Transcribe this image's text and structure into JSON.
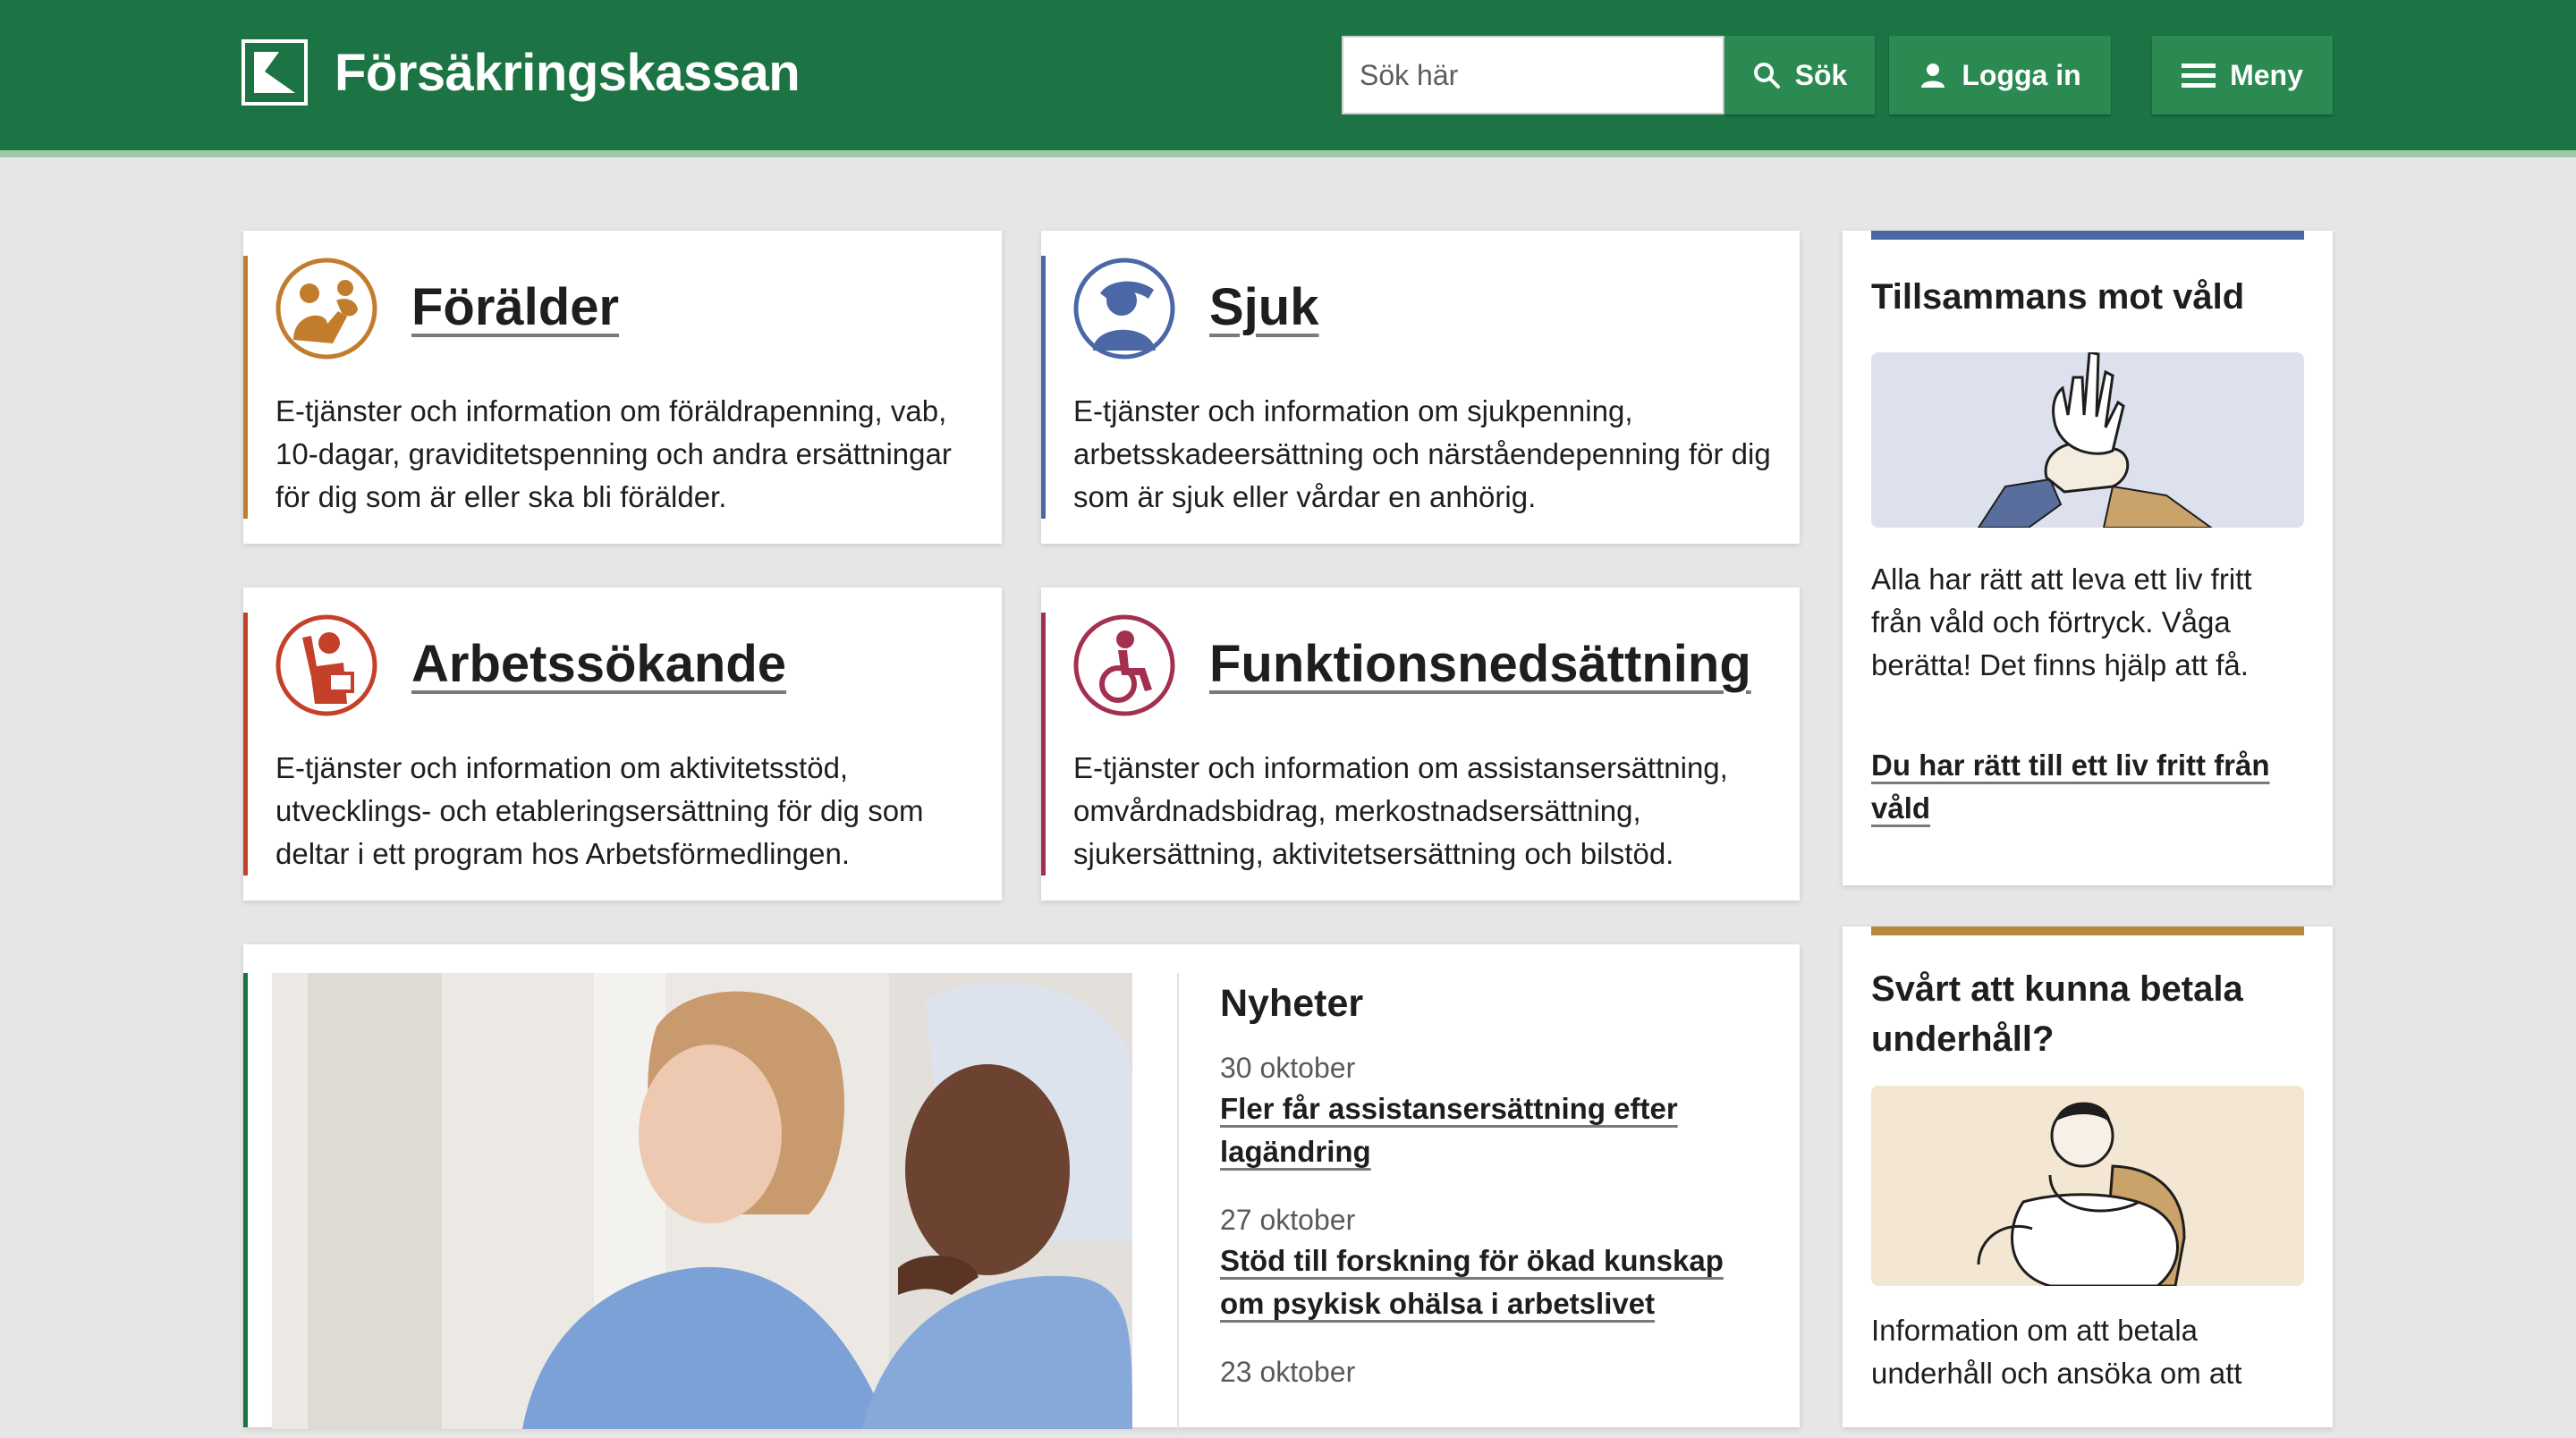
{
  "header": {
    "brand": "Försäkringskassan",
    "search_placeholder": "Sök här",
    "search_button": "Sök",
    "login_button": "Logga in",
    "menu_button": "Meny"
  },
  "topics": [
    {
      "title": "Förälder",
      "desc": "E-tjänster och information om föräldrapenning, vab, 10-dagar, graviditetspenning och andra ersättningar för dig som är eller ska bli förälder.",
      "color": "#c17d2c"
    },
    {
      "title": "Sjuk",
      "desc": "E-tjänster och information om sjukpenning, arbetsskadeersättning och närståendepenning för dig som är sjuk eller vårdar en anhörig.",
      "color": "#4b67a6"
    },
    {
      "title": "Arbetssökande",
      "desc": "E-tjänster och information om aktivitetsstöd, utvecklings- och etableringsersättning för dig som deltar i ett program hos Arbetsförmedlingen.",
      "color": "#c5402b"
    },
    {
      "title": "Funktionsnedsättning",
      "desc": "E-tjänster och information om assistansersättning, omvårdnadsbidrag, merkostnadsersättning, sjukersättning, aktivitetsersättning och bilstöd.",
      "color": "#a3304f"
    }
  ],
  "side_cards": [
    {
      "title": "Tillsammans mot våld",
      "text": "Alla har rätt att leva ett liv fritt från våld och förtryck. Våga berätta! Det finns hjälp att få.",
      "link": "Du har rätt till ett liv fritt från våld",
      "accent": "#4b67a6"
    },
    {
      "title": "Svårt att kunna betala underhåll?",
      "text": "Information om att betala underhåll och ansöka om att",
      "accent": "#b8893d"
    }
  ],
  "news": {
    "heading": "Nyheter",
    "items": [
      {
        "date": "30 oktober",
        "title": "Fler får assistansersättning efter lagändring"
      },
      {
        "date": "27 oktober",
        "title": "Stöd till forskning för ökad kunskap om psykisk ohälsa i arbetslivet"
      },
      {
        "date": "23 oktober",
        "title": ""
      }
    ]
  },
  "colors": {
    "header": "#1c7444",
    "header_button": "#2a8a52",
    "page_bg": "#e6e6e6"
  }
}
